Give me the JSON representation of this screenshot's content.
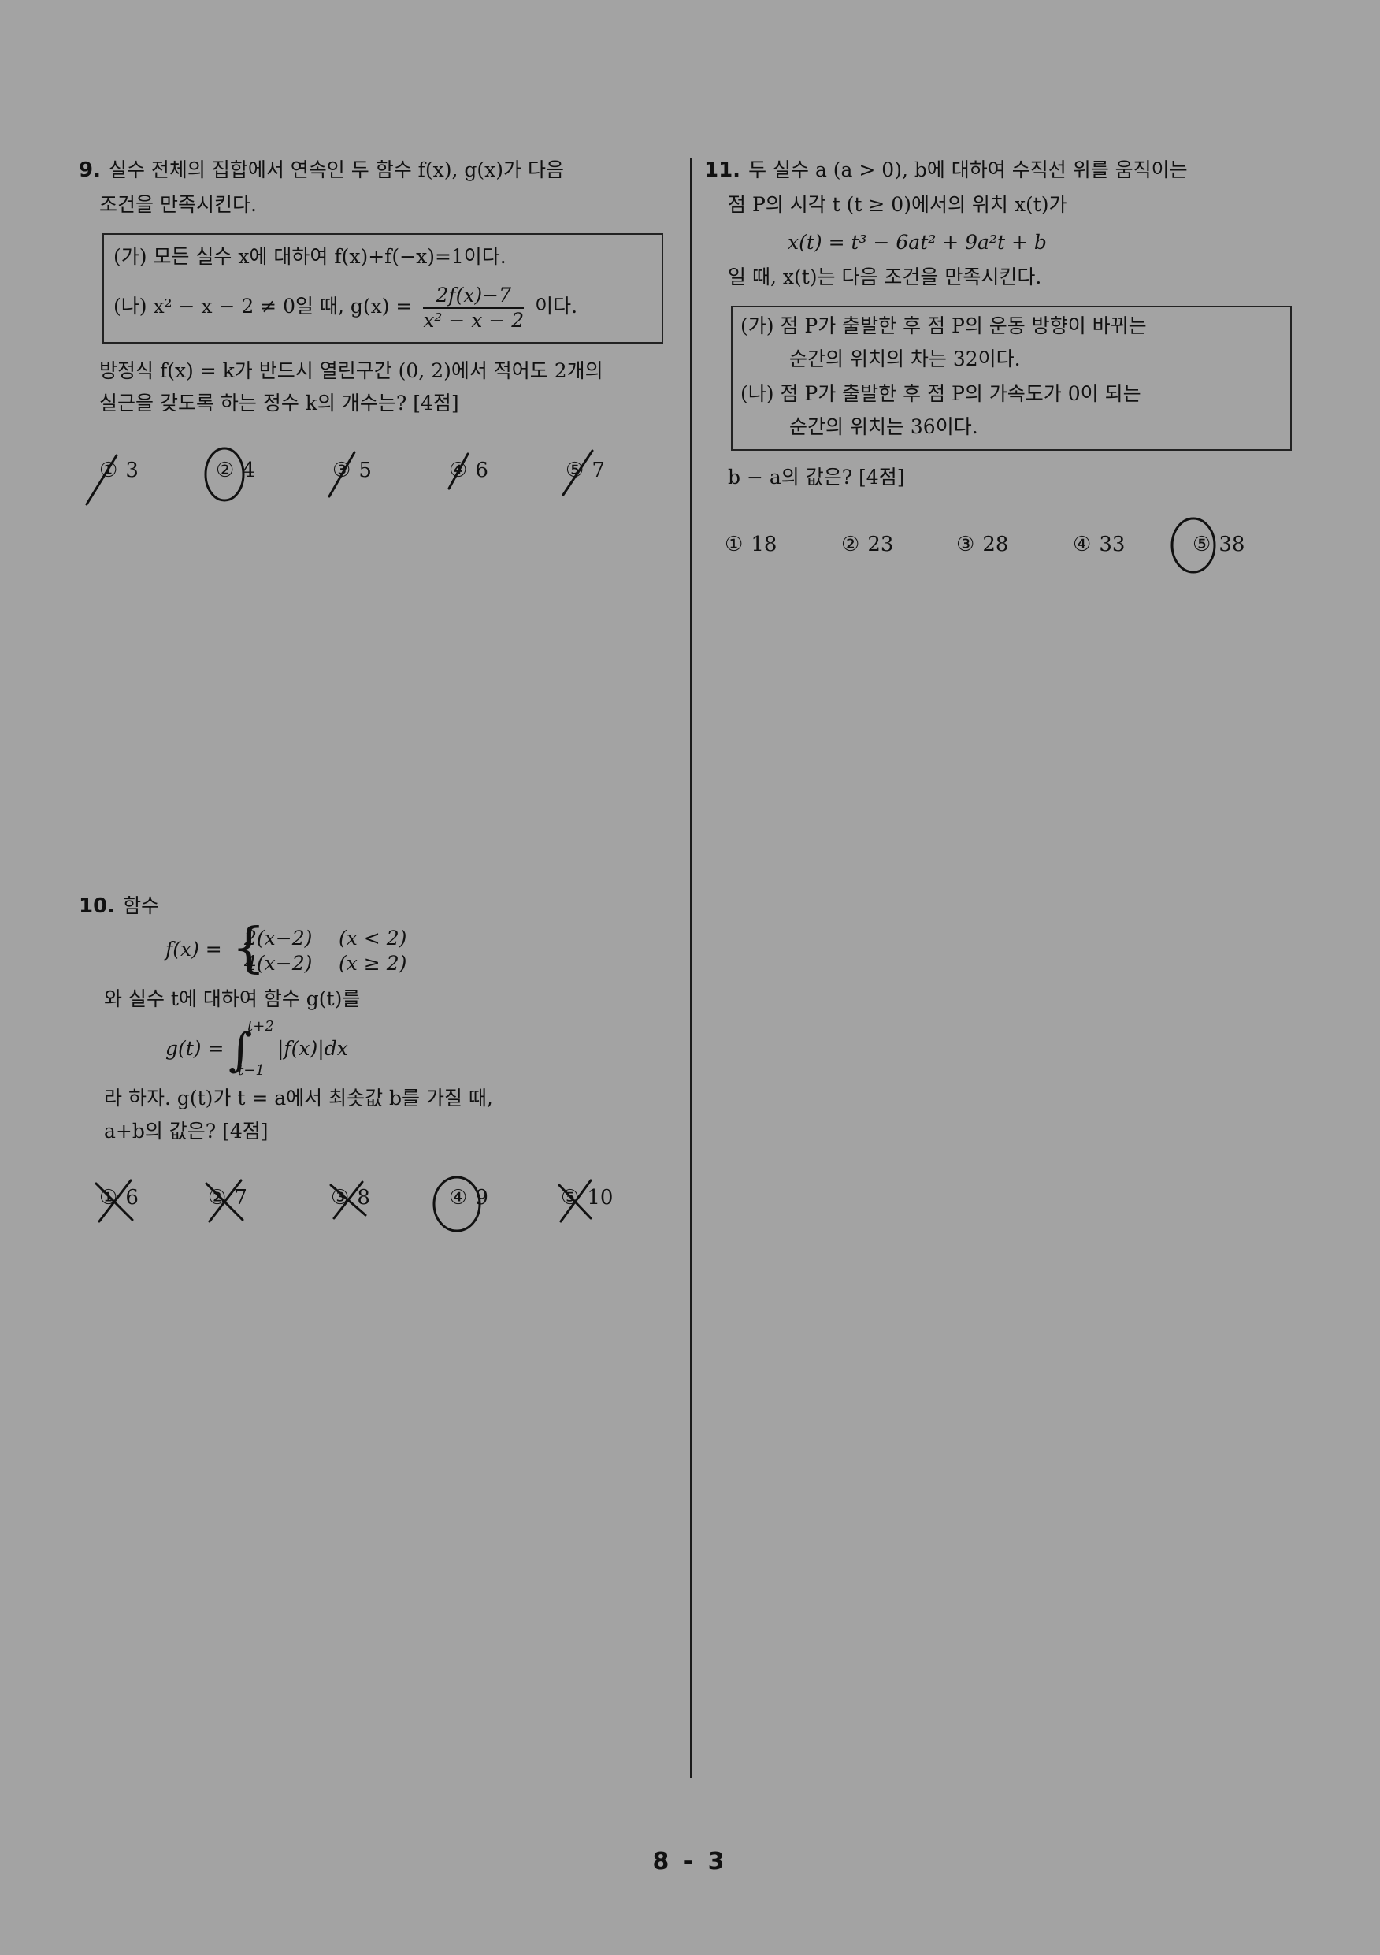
{
  "q9": {
    "number": "9.",
    "line1": "실수 전체의 집합에서 연속인 두 함수 f(x), g(x)가 다음",
    "line2": "조건을 만족시킨다.",
    "cond_a": "(가) 모든 실수 x에 대하여 f(x)+f(−x)=1이다.",
    "cond_b_pre": "(나) x² − x − 2 ≠ 0일 때, g(x) =",
    "cond_b_num": "2f(x)−7",
    "cond_b_den": "x² − x − 2",
    "cond_b_post": "이다.",
    "q_line1": "방정식 f(x) = k가 반드시 열린구간 (0, 2)에서 적어도 2개의",
    "q_line2": "실근을 갖도록 하는 정수 k의 개수는? [4점]",
    "choices": [
      {
        "mark": "①",
        "value": "3"
      },
      {
        "mark": "②",
        "value": "4"
      },
      {
        "mark": "③",
        "value": "5"
      },
      {
        "mark": "④",
        "value": "6"
      },
      {
        "mark": "⑤",
        "value": "7"
      }
    ]
  },
  "q10": {
    "number": "10.",
    "title": "함수",
    "f_lhs": "f(x) =",
    "case1_expr": "2(x−2)",
    "case1_cond": "(x < 2)",
    "case2_expr": "4(x−2)",
    "case2_cond": "(x ≥ 2)",
    "line_and": "와 실수 t에 대하여 함수 g(t)를",
    "g_lhs": "g(t) =",
    "int_upper": "t+2",
    "int_lower": "t−1",
    "int_body": "|f(x)|dx",
    "line_let": "라 하자. g(t)가 t = a에서 최솟값 b를 가질 때,",
    "line_q": "a+b의 값은? [4점]",
    "choices": [
      {
        "mark": "①",
        "value": "6"
      },
      {
        "mark": "②",
        "value": "7"
      },
      {
        "mark": "③",
        "value": "8"
      },
      {
        "mark": "④",
        "value": "9"
      },
      {
        "mark": "⑤",
        "value": "10"
      }
    ]
  },
  "q11": {
    "number": "11.",
    "line1": "두 실수 a (a > 0), b에 대하여 수직선 위를 움직이는",
    "line2": "점 P의 시각 t (t ≥ 0)에서의 위치 x(t)가",
    "formula": "x(t) = t³ − 6at² + 9a²t + b",
    "line3": "일 때, x(t)는 다음 조건을 만족시킨다.",
    "cond_a1": "(가) 점 P가 출발한 후 점 P의 운동 방향이 바뀌는",
    "cond_a2": "순간의 위치의 차는 32이다.",
    "cond_b1": "(나) 점 P가 출발한 후 점 P의 가속도가 0이 되는",
    "cond_b2": "순간의 위치는 36이다.",
    "question": "b − a의 값은? [4점]",
    "choices": [
      {
        "mark": "①",
        "value": "18"
      },
      {
        "mark": "②",
        "value": "23"
      },
      {
        "mark": "③",
        "value": "28"
      },
      {
        "mark": "④",
        "value": "33"
      },
      {
        "mark": "⑤",
        "value": "38"
      }
    ]
  },
  "page_number": "8 - 3",
  "colors": {
    "background": "#a3a3a3",
    "ink": "#111111"
  }
}
